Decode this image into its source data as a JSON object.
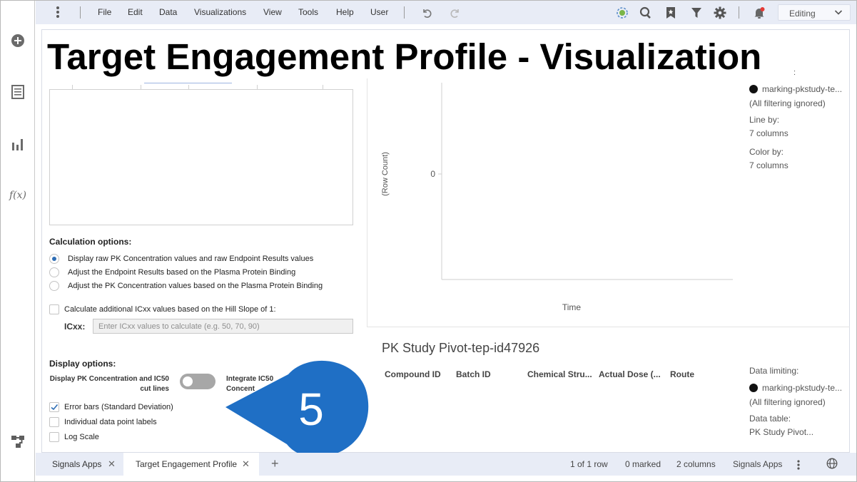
{
  "menu": {
    "items": [
      "File",
      "Edit",
      "Data",
      "Visualizations",
      "View",
      "Tools",
      "Help",
      "User"
    ],
    "mode": "Editing"
  },
  "page": {
    "title": "Target Engagement Profile - Visualization",
    "title_suffix": ":"
  },
  "calculation": {
    "heading": "Calculation options:",
    "options": [
      {
        "label": "Display raw PK Concentration values and raw Endpoint Results values",
        "selected": true
      },
      {
        "label": "Adjust the Endpoint Results based on the Plasma Protein Binding",
        "selected": false
      },
      {
        "label": "Adjust the PK Concentration values based on the Plasma Protein Binding",
        "selected": false
      }
    ],
    "hill_checkbox": "Calculate additional ICxx values based on the Hill Slope of 1:",
    "icxx_label": "ICxx:",
    "icxx_placeholder": "Enter ICxx values to calculate (e.g. 50, 70, 90)"
  },
  "display": {
    "heading": "Display options:",
    "pk_toggle_label_1": "Display PK Concentration and IC50",
    "pk_toggle_label_2": "cut lines",
    "integrate_label_1": "Integrate IC50",
    "integrate_label_2": "Concent",
    "checkboxes": [
      {
        "label": "Error bars (Standard Deviation)",
        "checked": true
      },
      {
        "label": "Individual data point labels",
        "checked": false
      },
      {
        "label": "Log Scale",
        "checked": false
      }
    ]
  },
  "chart_data": {
    "type": "line",
    "xlabel": "Time",
    "ylabel": "(Row Count)",
    "y_ticks": [
      "0"
    ],
    "series": []
  },
  "legend": {
    "marking": "marking-pkstudy-te...",
    "filtering": "(All filtering ignored)",
    "line_by_label": "Line by:",
    "line_by_value": "7 columns",
    "color_by_label": "Color by:",
    "color_by_value": "7 columns"
  },
  "table": {
    "title": "PK Study Pivot-tep-id47926",
    "columns": [
      "Compound ID",
      "Batch ID",
      "Chemical Stru...",
      "Actual Dose (...",
      "Route"
    ],
    "data_limiting_label": "Data limiting:",
    "marking": "marking-pkstudy-te...",
    "filtering": "(All filtering ignored)",
    "data_table_label": "Data table:",
    "data_table_value": "PK Study Pivot..."
  },
  "callout": {
    "number": "5",
    "color": "#1f6fc5"
  },
  "tabs": [
    {
      "label": "Signals Apps",
      "active": false
    },
    {
      "label": "Target Engagement Profile",
      "active": true
    }
  ],
  "status": {
    "rows": "1 of 1 row",
    "marked": "0 marked",
    "columns": "2 columns",
    "app": "Signals Apps"
  },
  "colors": {
    "accent": "#2e6db4",
    "toolbar_bg": "#e8ecf6"
  }
}
